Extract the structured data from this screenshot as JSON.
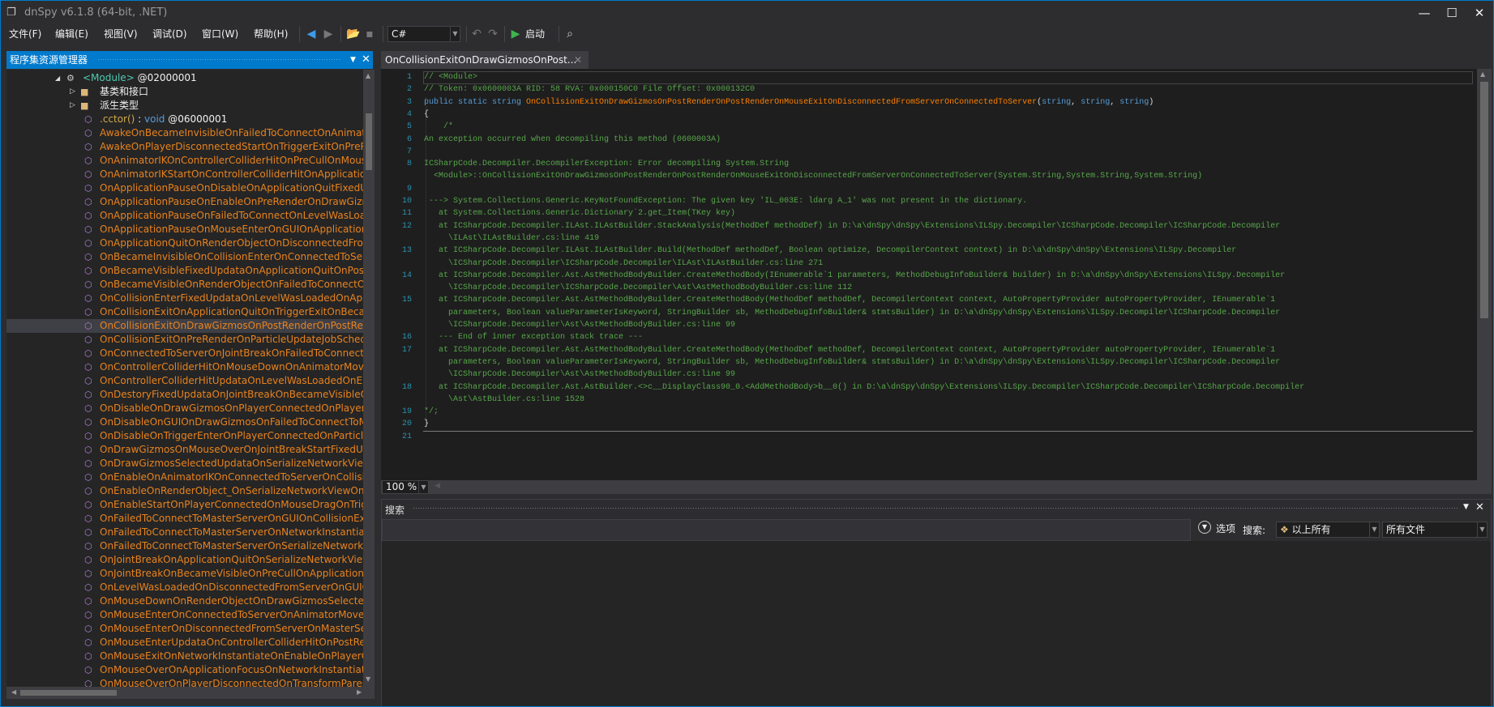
{
  "window": {
    "title": "dnSpy v6.1.8 (64-bit, .NET)",
    "controls": {
      "minimize": "—",
      "maximize": "☐",
      "close": "✕"
    }
  },
  "menu": [
    "文件(F)",
    "编辑(E)",
    "视图(V)",
    "调试(D)",
    "窗口(W)",
    "帮助(H)"
  ],
  "toolbar": {
    "language": "C#",
    "start_label": "启动"
  },
  "left_panel": {
    "title": "程序集资源管理器"
  },
  "tree": {
    "module": {
      "name": "<Module>",
      "token": "@02000001"
    },
    "folders": [
      "基类和接口",
      "派生类型"
    ],
    "ctor": {
      "name": ".cctor()",
      "sep": " : ",
      "type": "void",
      "token": " @06000001"
    },
    "selected_index": 14,
    "methods": [
      "AwakeOnBecameInvisibleOnFailedToConnectOnAnimatorMove",
      "AwakeOnPlayerDisconnectedStartOnTriggerExitOnPreRender",
      "OnAnimatorIKOnControllerColliderHitOnPreCullOnMouseDown",
      "OnAnimatorIKStartOnControllerColliderHitOnApplicationQuit",
      "OnApplicationPauseOnDisableOnApplicationQuitFixedUpdata",
      "OnApplicationPauseOnEnableOnPreRenderOnDrawGizmos",
      "OnApplicationPauseOnFailedToConnectOnLevelWasLoaded",
      "OnApplicationPauseOnMouseEnterOnGUIOnApplicationQuit",
      "OnApplicationQuitOnRenderObjectOnDisconnectedFromServer",
      "OnBecameInvisibleOnCollisionEnterOnConnectedToServer",
      "OnBecameVisibleFixedUpdataOnApplicationQuitOnPostRender",
      "OnBecameVisibleOnRenderObjectOnFailedToConnectOnGUI",
      "OnCollisionEnterFixedUpdataOnLevelWasLoadedOnApplicationQuit",
      "OnCollisionExitOnApplicationQuitOnTriggerExitOnBecameVisible",
      "OnCollisionExitOnDrawGizmosOnPostRenderOnPostRender",
      "OnCollisionExitOnPreRenderOnParticleUpdateJobScheduled",
      "OnConnectedToServerOnJointBreakOnFailedToConnectToMasterServer",
      "OnControllerColliderHitOnMouseDownOnAnimatorMove",
      "OnControllerColliderHitUpdataOnLevelWasLoadedOnEnable",
      "OnDestoryFixedUpdataOnJointBreakOnBecameVisibleOnGUI",
      "OnDisableOnDrawGizmosOnPlayerConnectedOnPlayerConnected",
      "OnDisableOnGUIOnDrawGizmosOnFailedToConnectToMasterServer",
      "OnDisableOnTriggerEnterOnPlayerConnectedOnParticleSystem",
      "OnDrawGizmosOnMouseOverOnJointBreakStartFixedUpdata",
      "OnDrawGizmosSelectedUpdataOnSerializeNetworkView",
      "OnEnableOnAnimatorIKOnConnectedToServerOnCollisionEnter",
      "OnEnableOnRenderObject_OnSerializeNetworkViewOnGUI",
      "OnEnableStartOnPlayerConnectedOnMouseDragOnTriggerEnter",
      "OnFailedToConnectToMasterServerOnGUIOnCollisionExit",
      "OnFailedToConnectToMasterServerOnNetworkInstantiate",
      "OnFailedToConnectToMasterServerOnSerializeNetworkView",
      "OnJointBreakOnApplicationQuitOnSerializeNetworkView",
      "OnJointBreakOnBecameVisibleOnPreCullOnApplicationFocus",
      "OnLevelWasLoadedOnDisconnectedFromServerOnGUIOnGUI",
      "OnMouseDownOnRenderObjectOnDrawGizmosSelected",
      "OnMouseEnterOnConnectedToServerOnAnimatorMove",
      "OnMouseEnterOnDisconnectedFromServerOnMasterServerEvent",
      "OnMouseEnterUpdataOnControllerColliderHitOnPostRender",
      "OnMouseExitOnNetworkInstantiateOnEnableOnPlayerConnected",
      "OnMouseOverOnApplicationFocusOnNetworkInstantiate",
      "OnMouseOverOnPlayerDisconnectedOnTransformParentChanged"
    ]
  },
  "editor": {
    "tab_title": "OnCollisionExitOnDrawGizmosOnPost...",
    "zoom": "100 %",
    "lines": [
      {
        "n": "1",
        "rows": [
          "// <Module>"
        ]
      },
      {
        "n": "2",
        "rows": [
          "// Token: 0x0600003A RID: 58 RVA: 0x000150C0 File Offset: 0x000132C0"
        ]
      },
      {
        "n": "3",
        "rows": [
          [
            {
              "t": "public static string ",
              "k": "kw"
            },
            {
              "t": "OnCollisionExitOnDrawGizmosOnPostRenderOnPostRenderOnMouseExitOnDisconnectedFromServerOnConnectedToServer",
              "k": "mt"
            },
            {
              "t": "(",
              "k": "pl"
            },
            {
              "t": "string",
              "k": "kw"
            },
            {
              "t": ", ",
              "k": "pl"
            },
            {
              "t": "string",
              "k": "kw"
            },
            {
              "t": ", ",
              "k": "pl"
            },
            {
              "t": "string",
              "k": "kw"
            },
            {
              "t": ")",
              "k": "pl"
            }
          ]
        ]
      },
      {
        "n": "4",
        "rows": [
          [
            {
              "t": "{",
              "k": "pl"
            }
          ]
        ]
      },
      {
        "n": "5",
        "rows": [
          "    /*"
        ]
      },
      {
        "n": "6",
        "rows": [
          "An exception occurred when decompiling this method (0600003A)"
        ]
      },
      {
        "n": "7",
        "rows": [
          ""
        ]
      },
      {
        "n": "8",
        "rows": [
          "ICSharpCode.Decompiler.DecompilerException: Error decompiling System.String",
          "  <Module>::OnCollisionExitOnDrawGizmosOnPostRenderOnPostRenderOnMouseExitOnDisconnectedFromServerOnConnectedToServer(System.String,System.String,System.String)"
        ]
      },
      {
        "n": "9",
        "rows": [
          ""
        ]
      },
      {
        "n": "10",
        "rows": [
          " ---> System.Collections.Generic.KeyNotFoundException: The given key 'IL_003E: ldarg A_1' was not present in the dictionary."
        ]
      },
      {
        "n": "11",
        "rows": [
          "   at System.Collections.Generic.Dictionary`2.get_Item(TKey key)"
        ]
      },
      {
        "n": "12",
        "rows": [
          "   at ICSharpCode.Decompiler.ILAst.ILAstBuilder.StackAnalysis(MethodDef methodDef) in D:\\a\\dnSpy\\dnSpy\\Extensions\\ILSpy.Decompiler\\ICSharpCode.Decompiler\\ICSharpCode.Decompiler",
          "     \\ILAst\\ILAstBuilder.cs:line 419"
        ]
      },
      {
        "n": "13",
        "rows": [
          "   at ICSharpCode.Decompiler.ILAst.ILAstBuilder.Build(MethodDef methodDef, Boolean optimize, DecompilerContext context) in D:\\a\\dnSpy\\dnSpy\\Extensions\\ILSpy.Decompiler",
          "     \\ICSharpCode.Decompiler\\ICSharpCode.Decompiler\\ILAst\\ILAstBuilder.cs:line 271"
        ]
      },
      {
        "n": "14",
        "rows": [
          "   at ICSharpCode.Decompiler.Ast.AstMethodBodyBuilder.CreateMethodBody(IEnumerable`1 parameters, MethodDebugInfoBuilder& builder) in D:\\a\\dnSpy\\dnSpy\\Extensions\\ILSpy.Decompiler",
          "     \\ICSharpCode.Decompiler\\ICSharpCode.Decompiler\\Ast\\AstMethodBodyBuilder.cs:line 112"
        ]
      },
      {
        "n": "15",
        "rows": [
          "   at ICSharpCode.Decompiler.Ast.AstMethodBodyBuilder.CreateMethodBody(MethodDef methodDef, DecompilerContext context, AutoPropertyProvider autoPropertyProvider, IEnumerable`1",
          "     parameters, Boolean valueParameterIsKeyword, StringBuilder sb, MethodDebugInfoBuilder& stmtsBuilder) in D:\\a\\dnSpy\\dnSpy\\Extensions\\ILSpy.Decompiler\\ICSharpCode.Decompiler",
          "     \\ICSharpCode.Decompiler\\Ast\\AstMethodBodyBuilder.cs:line 99"
        ]
      },
      {
        "n": "16",
        "rows": [
          "   --- End of inner exception stack trace ---"
        ]
      },
      {
        "n": "17",
        "rows": [
          "   at ICSharpCode.Decompiler.Ast.AstMethodBodyBuilder.CreateMethodBody(MethodDef methodDef, DecompilerContext context, AutoPropertyProvider autoPropertyProvider, IEnumerable`1",
          "     parameters, Boolean valueParameterIsKeyword, StringBuilder sb, MethodDebugInfoBuilder& stmtsBuilder) in D:\\a\\dnSpy\\dnSpy\\Extensions\\ILSpy.Decompiler\\ICSharpCode.Decompiler",
          "     \\ICSharpCode.Decompiler\\Ast\\AstMethodBodyBuilder.cs:line 99"
        ]
      },
      {
        "n": "18",
        "rows": [
          "   at ICSharpCode.Decompiler.Ast.AstBuilder.<>c__DisplayClass90_0.<AddMethodBody>b__0() in D:\\a\\dnSpy\\dnSpy\\Extensions\\ILSpy.Decompiler\\ICSharpCode.Decompiler\\ICSharpCode.Decompiler",
          "     \\Ast\\AstBuilder.cs:line 1528"
        ]
      },
      {
        "n": "19",
        "rows": [
          "*/;"
        ]
      },
      {
        "n": "20",
        "rows": [
          [
            {
              "t": "}",
              "k": "pl"
            }
          ]
        ]
      },
      {
        "n": "21",
        "rows": [
          ""
        ]
      }
    ]
  },
  "search": {
    "title": "搜索",
    "options_label": "选项",
    "search_label": "搜索:",
    "scope": "以上所有",
    "file_filter": "所有文件",
    "query": ""
  },
  "colors": {
    "accent": "#007acc",
    "method": "#e8831d",
    "comment": "#57a64a",
    "keyword": "#569cd6",
    "line_number": "#2b91af"
  }
}
